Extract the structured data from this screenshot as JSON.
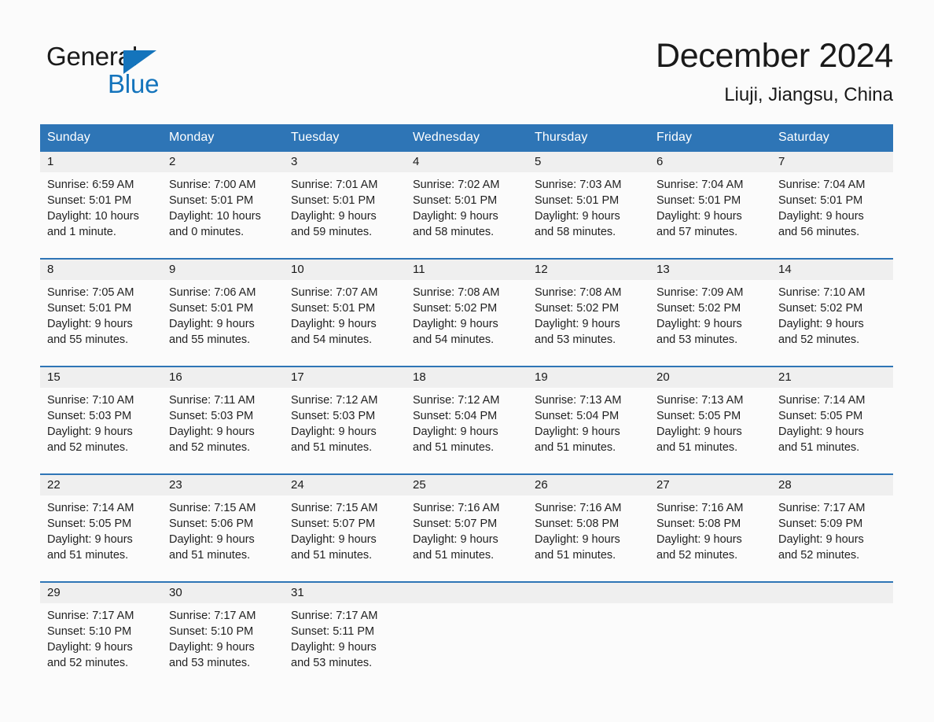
{
  "brand": {
    "name_part1": "General",
    "name_part2": "Blue",
    "triangle_icon": "triangle-icon",
    "accent_color": "#1474bc"
  },
  "header": {
    "month_title": "December 2024",
    "location": "Liuji, Jiangsu, China",
    "header_bg_color": "#2e75b6",
    "daynum_bg_color": "#efefef"
  },
  "weekday_headers": [
    "Sunday",
    "Monday",
    "Tuesday",
    "Wednesday",
    "Thursday",
    "Friday",
    "Saturday"
  ],
  "weeks": [
    [
      {
        "day": "1",
        "sunrise": "Sunrise: 6:59 AM",
        "sunset": "Sunset: 5:01 PM",
        "daylight_line1": "Daylight: 10 hours",
        "daylight_line2": "and 1 minute."
      },
      {
        "day": "2",
        "sunrise": "Sunrise: 7:00 AM",
        "sunset": "Sunset: 5:01 PM",
        "daylight_line1": "Daylight: 10 hours",
        "daylight_line2": "and 0 minutes."
      },
      {
        "day": "3",
        "sunrise": "Sunrise: 7:01 AM",
        "sunset": "Sunset: 5:01 PM",
        "daylight_line1": "Daylight: 9 hours",
        "daylight_line2": "and 59 minutes."
      },
      {
        "day": "4",
        "sunrise": "Sunrise: 7:02 AM",
        "sunset": "Sunset: 5:01 PM",
        "daylight_line1": "Daylight: 9 hours",
        "daylight_line2": "and 58 minutes."
      },
      {
        "day": "5",
        "sunrise": "Sunrise: 7:03 AM",
        "sunset": "Sunset: 5:01 PM",
        "daylight_line1": "Daylight: 9 hours",
        "daylight_line2": "and 58 minutes."
      },
      {
        "day": "6",
        "sunrise": "Sunrise: 7:04 AM",
        "sunset": "Sunset: 5:01 PM",
        "daylight_line1": "Daylight: 9 hours",
        "daylight_line2": "and 57 minutes."
      },
      {
        "day": "7",
        "sunrise": "Sunrise: 7:04 AM",
        "sunset": "Sunset: 5:01 PM",
        "daylight_line1": "Daylight: 9 hours",
        "daylight_line2": "and 56 minutes."
      }
    ],
    [
      {
        "day": "8",
        "sunrise": "Sunrise: 7:05 AM",
        "sunset": "Sunset: 5:01 PM",
        "daylight_line1": "Daylight: 9 hours",
        "daylight_line2": "and 55 minutes."
      },
      {
        "day": "9",
        "sunrise": "Sunrise: 7:06 AM",
        "sunset": "Sunset: 5:01 PM",
        "daylight_line1": "Daylight: 9 hours",
        "daylight_line2": "and 55 minutes."
      },
      {
        "day": "10",
        "sunrise": "Sunrise: 7:07 AM",
        "sunset": "Sunset: 5:01 PM",
        "daylight_line1": "Daylight: 9 hours",
        "daylight_line2": "and 54 minutes."
      },
      {
        "day": "11",
        "sunrise": "Sunrise: 7:08 AM",
        "sunset": "Sunset: 5:02 PM",
        "daylight_line1": "Daylight: 9 hours",
        "daylight_line2": "and 54 minutes."
      },
      {
        "day": "12",
        "sunrise": "Sunrise: 7:08 AM",
        "sunset": "Sunset: 5:02 PM",
        "daylight_line1": "Daylight: 9 hours",
        "daylight_line2": "and 53 minutes."
      },
      {
        "day": "13",
        "sunrise": "Sunrise: 7:09 AM",
        "sunset": "Sunset: 5:02 PM",
        "daylight_line1": "Daylight: 9 hours",
        "daylight_line2": "and 53 minutes."
      },
      {
        "day": "14",
        "sunrise": "Sunrise: 7:10 AM",
        "sunset": "Sunset: 5:02 PM",
        "daylight_line1": "Daylight: 9 hours",
        "daylight_line2": "and 52 minutes."
      }
    ],
    [
      {
        "day": "15",
        "sunrise": "Sunrise: 7:10 AM",
        "sunset": "Sunset: 5:03 PM",
        "daylight_line1": "Daylight: 9 hours",
        "daylight_line2": "and 52 minutes."
      },
      {
        "day": "16",
        "sunrise": "Sunrise: 7:11 AM",
        "sunset": "Sunset: 5:03 PM",
        "daylight_line1": "Daylight: 9 hours",
        "daylight_line2": "and 52 minutes."
      },
      {
        "day": "17",
        "sunrise": "Sunrise: 7:12 AM",
        "sunset": "Sunset: 5:03 PM",
        "daylight_line1": "Daylight: 9 hours",
        "daylight_line2": "and 51 minutes."
      },
      {
        "day": "18",
        "sunrise": "Sunrise: 7:12 AM",
        "sunset": "Sunset: 5:04 PM",
        "daylight_line1": "Daylight: 9 hours",
        "daylight_line2": "and 51 minutes."
      },
      {
        "day": "19",
        "sunrise": "Sunrise: 7:13 AM",
        "sunset": "Sunset: 5:04 PM",
        "daylight_line1": "Daylight: 9 hours",
        "daylight_line2": "and 51 minutes."
      },
      {
        "day": "20",
        "sunrise": "Sunrise: 7:13 AM",
        "sunset": "Sunset: 5:05 PM",
        "daylight_line1": "Daylight: 9 hours",
        "daylight_line2": "and 51 minutes."
      },
      {
        "day": "21",
        "sunrise": "Sunrise: 7:14 AM",
        "sunset": "Sunset: 5:05 PM",
        "daylight_line1": "Daylight: 9 hours",
        "daylight_line2": "and 51 minutes."
      }
    ],
    [
      {
        "day": "22",
        "sunrise": "Sunrise: 7:14 AM",
        "sunset": "Sunset: 5:05 PM",
        "daylight_line1": "Daylight: 9 hours",
        "daylight_line2": "and 51 minutes."
      },
      {
        "day": "23",
        "sunrise": "Sunrise: 7:15 AM",
        "sunset": "Sunset: 5:06 PM",
        "daylight_line1": "Daylight: 9 hours",
        "daylight_line2": "and 51 minutes."
      },
      {
        "day": "24",
        "sunrise": "Sunrise: 7:15 AM",
        "sunset": "Sunset: 5:07 PM",
        "daylight_line1": "Daylight: 9 hours",
        "daylight_line2": "and 51 minutes."
      },
      {
        "day": "25",
        "sunrise": "Sunrise: 7:16 AM",
        "sunset": "Sunset: 5:07 PM",
        "daylight_line1": "Daylight: 9 hours",
        "daylight_line2": "and 51 minutes."
      },
      {
        "day": "26",
        "sunrise": "Sunrise: 7:16 AM",
        "sunset": "Sunset: 5:08 PM",
        "daylight_line1": "Daylight: 9 hours",
        "daylight_line2": "and 51 minutes."
      },
      {
        "day": "27",
        "sunrise": "Sunrise: 7:16 AM",
        "sunset": "Sunset: 5:08 PM",
        "daylight_line1": "Daylight: 9 hours",
        "daylight_line2": "and 52 minutes."
      },
      {
        "day": "28",
        "sunrise": "Sunrise: 7:17 AM",
        "sunset": "Sunset: 5:09 PM",
        "daylight_line1": "Daylight: 9 hours",
        "daylight_line2": "and 52 minutes."
      }
    ],
    [
      {
        "day": "29",
        "sunrise": "Sunrise: 7:17 AM",
        "sunset": "Sunset: 5:10 PM",
        "daylight_line1": "Daylight: 9 hours",
        "daylight_line2": "and 52 minutes."
      },
      {
        "day": "30",
        "sunrise": "Sunrise: 7:17 AM",
        "sunset": "Sunset: 5:10 PM",
        "daylight_line1": "Daylight: 9 hours",
        "daylight_line2": "and 53 minutes."
      },
      {
        "day": "31",
        "sunrise": "Sunrise: 7:17 AM",
        "sunset": "Sunset: 5:11 PM",
        "daylight_line1": "Daylight: 9 hours",
        "daylight_line2": "and 53 minutes."
      },
      {
        "day": "",
        "sunrise": "",
        "sunset": "",
        "daylight_line1": "",
        "daylight_line2": "",
        "empty": true
      },
      {
        "day": "",
        "sunrise": "",
        "sunset": "",
        "daylight_line1": "",
        "daylight_line2": "",
        "empty": true
      },
      {
        "day": "",
        "sunrise": "",
        "sunset": "",
        "daylight_line1": "",
        "daylight_line2": "",
        "empty": true
      },
      {
        "day": "",
        "sunrise": "",
        "sunset": "",
        "daylight_line1": "",
        "daylight_line2": "",
        "empty": true
      }
    ]
  ]
}
